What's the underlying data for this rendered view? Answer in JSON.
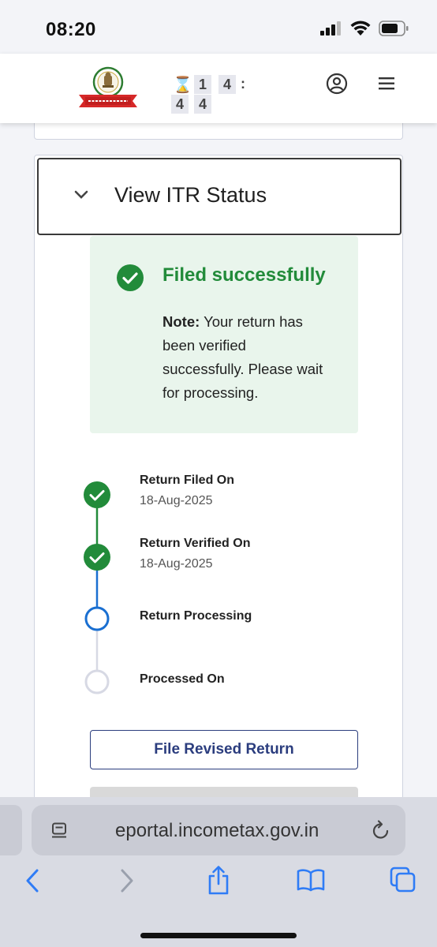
{
  "status_bar": {
    "time": "08:20"
  },
  "header": {
    "timer": {
      "glyph": "⌛",
      "digits": [
        "1",
        "4",
        "4",
        "4"
      ],
      "separator": ":"
    }
  },
  "itr": {
    "title": "View ITR Status",
    "status": {
      "heading": "Filed successfully",
      "note_label": "Note:",
      "note_text": " Your return has been verified successfully. Please wait for processing."
    },
    "timeline": [
      {
        "label": "Return Filed On",
        "date": "18-Aug-2025",
        "state": "done"
      },
      {
        "label": "Return Verified On",
        "date": "18-Aug-2025",
        "state": "done"
      },
      {
        "label": "Return Processing",
        "date": "",
        "state": "current"
      },
      {
        "label": "Processed On",
        "date": "",
        "state": "pending"
      }
    ],
    "revise_button": "File Revised Return"
  },
  "browser": {
    "url": "eportal.incometax.gov.in",
    "toolbar": [
      "back-icon",
      "forward-icon",
      "share-icon",
      "bookmarks-icon",
      "tabs-icon"
    ]
  },
  "colors": {
    "success": "#228b3a",
    "success_bg": "#e9f5ec",
    "primary": "#2b3d7e",
    "current": "#1a6fd1",
    "safari_blue": "#2f7cf6"
  }
}
